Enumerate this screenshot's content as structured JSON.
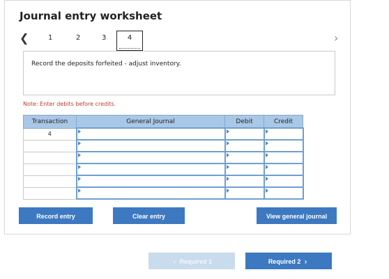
{
  "worksheet": {
    "title": "Journal entry worksheet",
    "prev_icon": "chevron-left-icon",
    "next_icon": "chevron-right-icon",
    "steps": [
      "1",
      "2",
      "3",
      "4"
    ],
    "instruction": "Record the deposits forfeited - adjust inventory.",
    "note": "Note: Enter debits before credits."
  },
  "table": {
    "headers": [
      "Transaction",
      "General Journal",
      "Debit",
      "Credit"
    ],
    "rows": [
      {
        "transaction": "4"
      },
      {
        "transaction": ""
      },
      {
        "transaction": ""
      },
      {
        "transaction": ""
      },
      {
        "transaction": ""
      },
      {
        "transaction": ""
      }
    ]
  },
  "buttons": {
    "record": "Record entry",
    "clear": "Clear entry",
    "view": "View general journal"
  },
  "footer": {
    "prev_label": "Required 1",
    "next_label": "Required 2"
  }
}
